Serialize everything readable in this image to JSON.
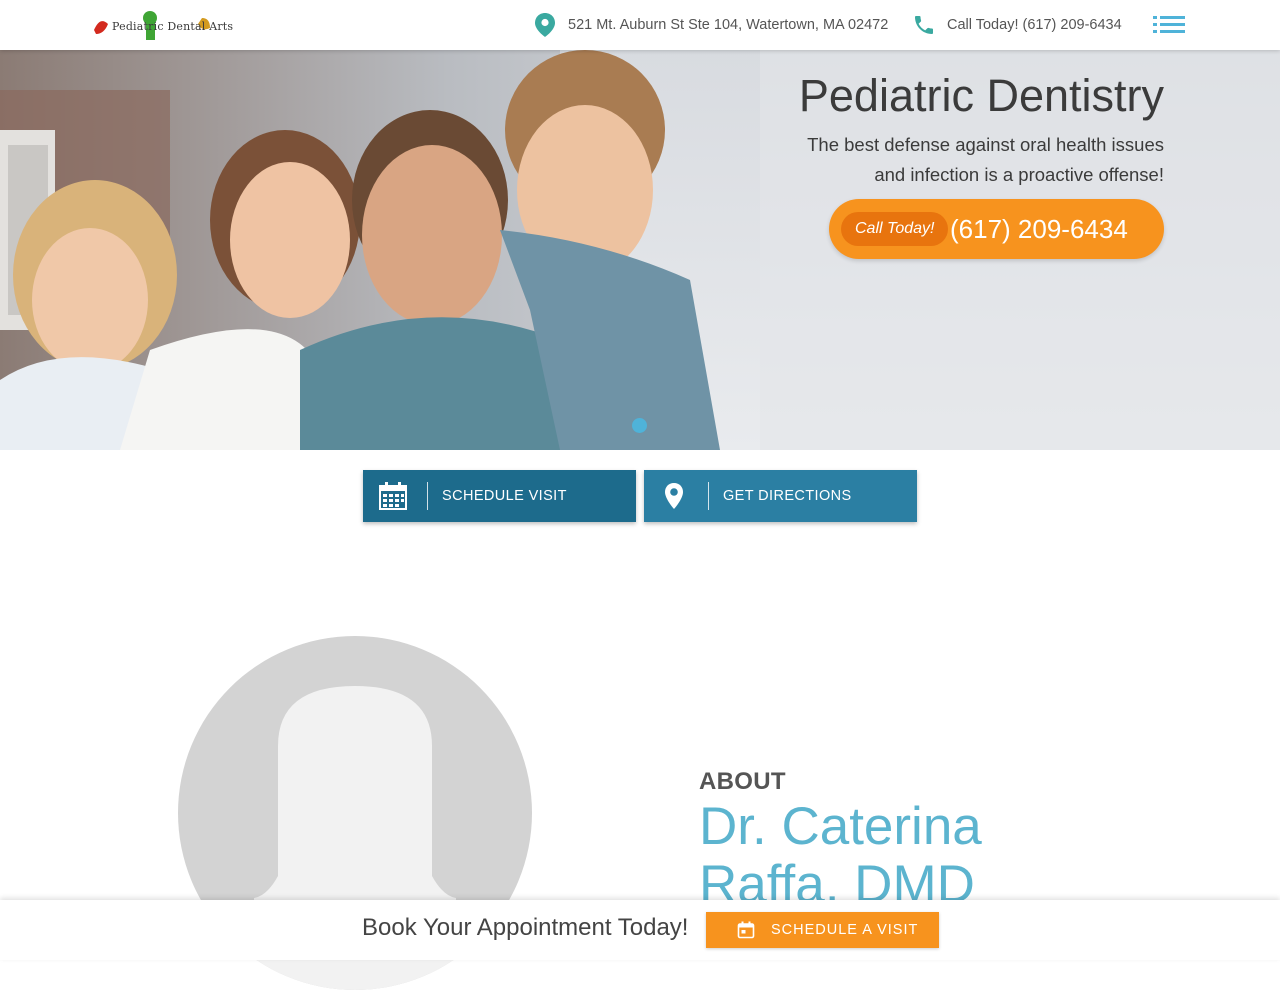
{
  "header": {
    "logo_text": "Pediatric Dental Arts",
    "address": "521 Mt. Auburn St Ste 104, Watertown, MA 02472",
    "phone": "Call Today! (617) 209-6434"
  },
  "hero": {
    "title": "Pediatric Dentistry",
    "subtitle": "The best defense against oral health issues and infection is a proactive offense!",
    "cta_label": "Call Today!",
    "cta_phone": "(617) 209-6434"
  },
  "actions": {
    "schedule_label": "SCHEDULE VISIT",
    "directions_label": "GET DIRECTIONS"
  },
  "about": {
    "kicker": "ABOUT",
    "name": "Dr. Caterina Raffa, DMD"
  },
  "booking": {
    "text": "Book Your Appointment Today!",
    "button_label": "SCHEDULE A VISIT"
  },
  "colors": {
    "accent_orange": "#f7931e",
    "teal_dark": "#1d6b8c",
    "teal": "#2b7fa3",
    "name_blue": "#5cb4cf"
  },
  "icons": [
    "location-pin-icon",
    "phone-icon",
    "menu-list-icon",
    "calendar-icon",
    "map-pin-icon"
  ]
}
